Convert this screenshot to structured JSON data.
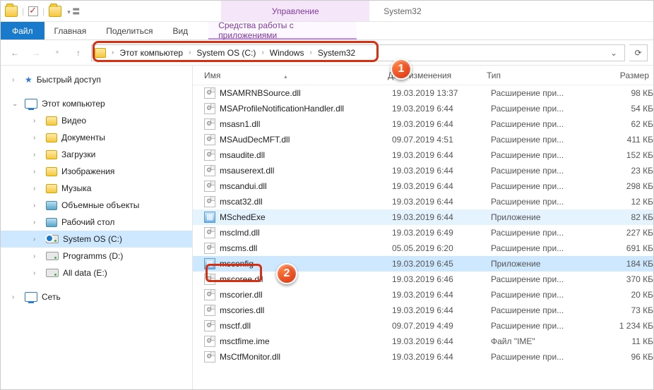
{
  "titlebar": {
    "context_tab": "Управление",
    "window_title": "System32"
  },
  "ribbon": {
    "file": "Файл",
    "home": "Главная",
    "share": "Поделиться",
    "view": "Вид",
    "context": "Средства работы с приложениями"
  },
  "breadcrumb": {
    "items": [
      "Этот компьютер",
      "System OS (C:)",
      "Windows",
      "System32"
    ]
  },
  "columns": {
    "name": "Имя",
    "date": "Дата изменения",
    "type": "Тип",
    "size": "Размер"
  },
  "sidebar": {
    "quick": "Быстрый доступ",
    "pc": "Этот компьютер",
    "video": "Видео",
    "docs": "Документы",
    "downloads": "Загрузки",
    "pictures": "Изображения",
    "music": "Музыка",
    "objects3d": "Объемные объекты",
    "desktop": "Рабочий стол",
    "drive_c": "System OS (C:)",
    "drive_d": "Programms (D:)",
    "drive_e": "All data (E:)",
    "network": "Сеть"
  },
  "badges": {
    "one": "1",
    "two": "2"
  },
  "type_labels": {
    "dll": "Расширение при...",
    "app": "Приложение",
    "ime": "Файл \"IME\""
  },
  "files": [
    {
      "name": "MSAMRNBSource.dll",
      "date": "19.03.2019 13:37",
      "type": "dll",
      "size": "98 КБ"
    },
    {
      "name": "MSAProfileNotificationHandler.dll",
      "date": "19.03.2019 6:44",
      "type": "dll",
      "size": "54 КБ"
    },
    {
      "name": "msasn1.dll",
      "date": "19.03.2019 6:44",
      "type": "dll",
      "size": "62 КБ"
    },
    {
      "name": "MSAudDecMFT.dll",
      "date": "09.07.2019 4:51",
      "type": "dll",
      "size": "411 КБ"
    },
    {
      "name": "msaudite.dll",
      "date": "19.03.2019 6:44",
      "type": "dll",
      "size": "152 КБ"
    },
    {
      "name": "msauserext.dll",
      "date": "19.03.2019 6:44",
      "type": "dll",
      "size": "23 КБ"
    },
    {
      "name": "mscandui.dll",
      "date": "19.03.2019 6:44",
      "type": "dll",
      "size": "298 КБ"
    },
    {
      "name": "mscat32.dll",
      "date": "19.03.2019 6:44",
      "type": "dll",
      "size": "12 КБ"
    },
    {
      "name": "MSchedExe",
      "date": "19.03.2019 6:44",
      "type": "app",
      "size": "82 КБ",
      "hov": true
    },
    {
      "name": "msclmd.dll",
      "date": "19.03.2019 6:49",
      "type": "dll",
      "size": "227 КБ"
    },
    {
      "name": "mscms.dll",
      "date": "05.05.2019 6:20",
      "type": "dll",
      "size": "691 КБ"
    },
    {
      "name": "msconfig",
      "date": "19.03.2019 6:45",
      "type": "app",
      "size": "184 КБ",
      "sel": true
    },
    {
      "name": "mscoree.dll",
      "date": "19.03.2019 6:46",
      "type": "dll",
      "size": "370 КБ"
    },
    {
      "name": "mscorier.dll",
      "date": "19.03.2019 6:44",
      "type": "dll",
      "size": "20 КБ"
    },
    {
      "name": "mscories.dll",
      "date": "19.03.2019 6:44",
      "type": "dll",
      "size": "73 КБ"
    },
    {
      "name": "msctf.dll",
      "date": "09.07.2019 4:49",
      "type": "dll",
      "size": "1 234 КБ"
    },
    {
      "name": "msctfime.ime",
      "date": "19.03.2019 6:44",
      "type": "ime",
      "size": "11 КБ"
    },
    {
      "name": "MsCtfMonitor.dll",
      "date": "19.03.2019 6:44",
      "type": "dll",
      "size": "96 КБ"
    }
  ]
}
